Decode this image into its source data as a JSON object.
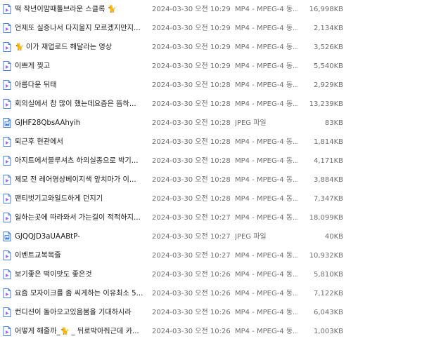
{
  "files": [
    {
      "name": "떡 작년이맘때톨브라운 스클록 🐈",
      "date": "2024-03-30 오전 10:29",
      "type": "MP4 - MPEG-4 동...",
      "size": "16,998KB",
      "icon": "video-file-icon"
    },
    {
      "name": "언제또 실증나서 다지울지 모르겠지만지...",
      "date": "2024-03-30 오전 10:29",
      "type": "MP4 - MPEG-4 동...",
      "size": "2,134KB",
      "icon": "video-file-icon"
    },
    {
      "name": "🐈 이가 재업로드 해달라는 영상",
      "date": "2024-03-30 오전 10:29",
      "type": "MP4 - MPEG-4 동...",
      "size": "3,526KB",
      "icon": "video-file-icon"
    },
    {
      "name": "이쁘게 찢고",
      "date": "2024-03-30 오전 10:29",
      "type": "MP4 - MPEG-4 동...",
      "size": "5,540KB",
      "icon": "video-file-icon"
    },
    {
      "name": "아름다운 뒤태",
      "date": "2024-03-30 오전 10:28",
      "type": "MP4 - MPEG-4 동...",
      "size": "2,929KB",
      "icon": "video-file-icon"
    },
    {
      "name": "회의실에서 참 많이 했는데요즘은 뜸하...",
      "date": "2024-03-30 오전 10:28",
      "type": "MP4 - MPEG-4 동...",
      "size": "13,239KB",
      "icon": "video-file-icon"
    },
    {
      "name": "GJHF28QbsAAhyih",
      "date": "2024-03-30 오전 10:28",
      "type": "JPEG 파일",
      "size": "83KB",
      "icon": "image-file-icon"
    },
    {
      "name": "퇴근후 현관에서",
      "date": "2024-03-30 오전 10:28",
      "type": "MP4 - MPEG-4 동...",
      "size": "1,814KB",
      "icon": "video-file-icon"
    },
    {
      "name": "아지트에서블루셔츠 하의실종으로 박기...",
      "date": "2024-03-30 오전 10:28",
      "type": "MP4 - MPEG-4 동...",
      "size": "4,171KB",
      "icon": "video-file-icon"
    },
    {
      "name": "제모 전   레어영상베이지색 앞치마가 이...",
      "date": "2024-03-30 오전 10:28",
      "type": "MP4 - MPEG-4 동...",
      "size": "3,884KB",
      "icon": "video-file-icon"
    },
    {
      "name": "팬티벗기고와일드하게 던지기",
      "date": "2024-03-30 오전 10:28",
      "type": "MP4 - MPEG-4 동...",
      "size": "7,347KB",
      "icon": "video-file-icon"
    },
    {
      "name": "일하는곳에 따라와서 가는길이 적적하지...",
      "date": "2024-03-30 오전 10:27",
      "type": "MP4 - MPEG-4 동...",
      "size": "18,099KB",
      "icon": "video-file-icon"
    },
    {
      "name": "GJQQJD3aUAABtP-",
      "date": "2024-03-30 오전 10:27",
      "type": "JPEG 파일",
      "size": "40KB",
      "icon": "image-file-icon"
    },
    {
      "name": "이벤트교복목줄",
      "date": "2024-03-30 오전 10:27",
      "type": "MP4 - MPEG-4 동...",
      "size": "10,932KB",
      "icon": "video-file-icon"
    },
    {
      "name": "보기좋은 떡이맛도 좋은것",
      "date": "2024-03-30 오전 10:26",
      "type": "MP4 - MPEG-4 동...",
      "size": "5,810KB",
      "icon": "video-file-icon"
    },
    {
      "name": "요즘 모자이크를 좀 씨게하는 이유최소 5...",
      "date": "2024-03-30 오전 10:26",
      "type": "MP4 - MPEG-4 동...",
      "size": "7,122KB",
      "icon": "video-file-icon"
    },
    {
      "name": "컨디션이 돌아오고있음봄을 기대하시라",
      "date": "2024-03-30 오전 10:26",
      "type": "MP4 - MPEG-4 동...",
      "size": "6,043KB",
      "icon": "video-file-icon"
    },
    {
      "name": "어떻게 해줄까_🐈 _ 뒤로박아줘근데 카...",
      "date": "2024-03-30 오전 10:26",
      "type": "MP4 - MPEG-4 동...",
      "size": "1,003KB",
      "icon": "video-file-icon"
    }
  ],
  "colors": {
    "video_icon_frame": "#4a7fd4",
    "video_icon_accent": "#9b6fe0",
    "image_icon_frame": "#3a78d0",
    "secondary_text": "#6d6d6d"
  }
}
